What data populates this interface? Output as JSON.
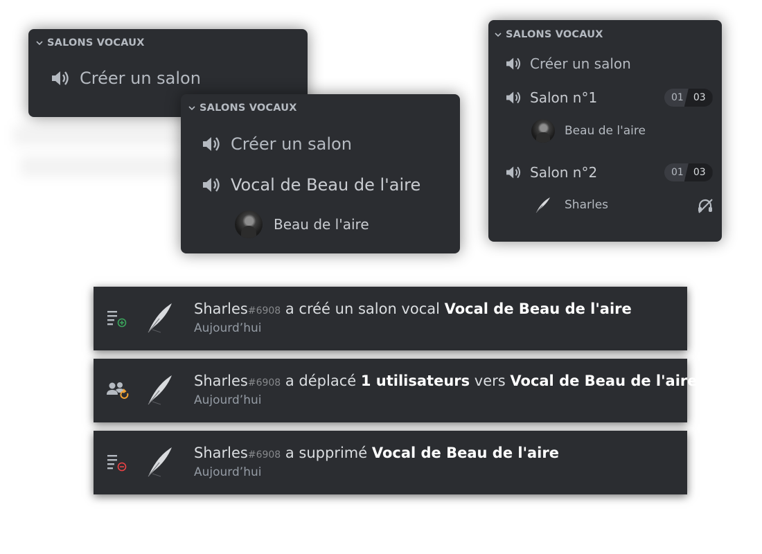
{
  "panel_a": {
    "header": "SALONS VOCAUX",
    "create": "Créer un salon"
  },
  "panel_b": {
    "header": "SALONS VOCAUX",
    "create": "Créer un salon",
    "channel": "Vocal de Beau de l'aire",
    "member": "Beau de l'aire"
  },
  "panel_c": {
    "header": "SALONS VOCAUX",
    "create": "Créer un salon",
    "channels": [
      {
        "name": "Salon n°1",
        "count": "01",
        "limit": "03",
        "member": "Beau de l'aire"
      },
      {
        "name": "Salon n°2",
        "count": "01",
        "limit": "03",
        "member": "Sharles"
      }
    ]
  },
  "logs": [
    {
      "icon": "channel-create-icon",
      "user": "Sharles",
      "discriminator": "#6908",
      "action": " a créé un salon vocal ",
      "target": "Vocal de Beau de l'aire",
      "time": "Aujourd’hui"
    },
    {
      "icon": "member-move-icon",
      "user": "Sharles",
      "discriminator": "#6908",
      "action": " a déplacé ",
      "count": "1 utilisateurs",
      "mid": " vers ",
      "target": "Vocal de Beau de l'aire",
      "time": "Aujourd’hui"
    },
    {
      "icon": "channel-delete-icon",
      "user": "Sharles",
      "discriminator": "#6908",
      "action": " a supprimé ",
      "target": "Vocal de Beau de l'aire",
      "time": "Aujourd’hui"
    }
  ],
  "colors": {
    "panel_bg": "#2b2d31",
    "text": "#dbdee1",
    "muted": "#949ba4",
    "create_green": "#3ba55c",
    "delete_red": "#ed4245",
    "move_orange": "#f0a232"
  }
}
